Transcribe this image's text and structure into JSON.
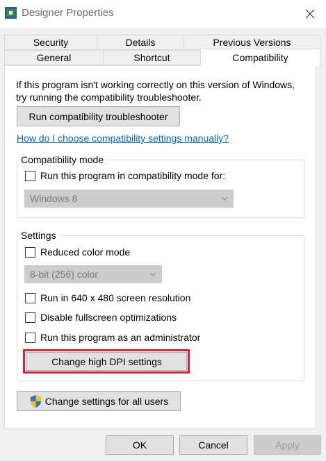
{
  "window": {
    "title": "Designer Properties"
  },
  "tabs": {
    "row1": [
      "Security",
      "Details",
      "Previous Versions"
    ],
    "row2": [
      "General",
      "Shortcut",
      "Compatibility"
    ],
    "active": "Compatibility"
  },
  "compat": {
    "description": "If this program isn't working correctly on this version of Windows, try running the compatibility troubleshooter.",
    "troubleshooter_button": "Run compatibility troubleshooter",
    "manual_link": "How do I choose compatibility settings manually?",
    "mode_group_label": "Compatibility mode",
    "mode_checkbox_label": "Run this program in compatibility mode for:",
    "mode_select_value": "Windows 8",
    "settings_group_label": "Settings",
    "reduced_color_label": "Reduced color mode",
    "color_select_value": "8-bit (256) color",
    "resolution_label": "Run in 640 x 480 screen resolution",
    "fullscreen_label": "Disable fullscreen optimizations",
    "admin_label": "Run this program as an administrator",
    "dpi_button": "Change high DPI settings",
    "all_users_button": "Change settings for all users"
  },
  "footer": {
    "ok": "OK",
    "cancel": "Cancel",
    "apply": "Apply"
  },
  "colors": {
    "highlight": "#e0202e",
    "link": "#0066cc"
  }
}
